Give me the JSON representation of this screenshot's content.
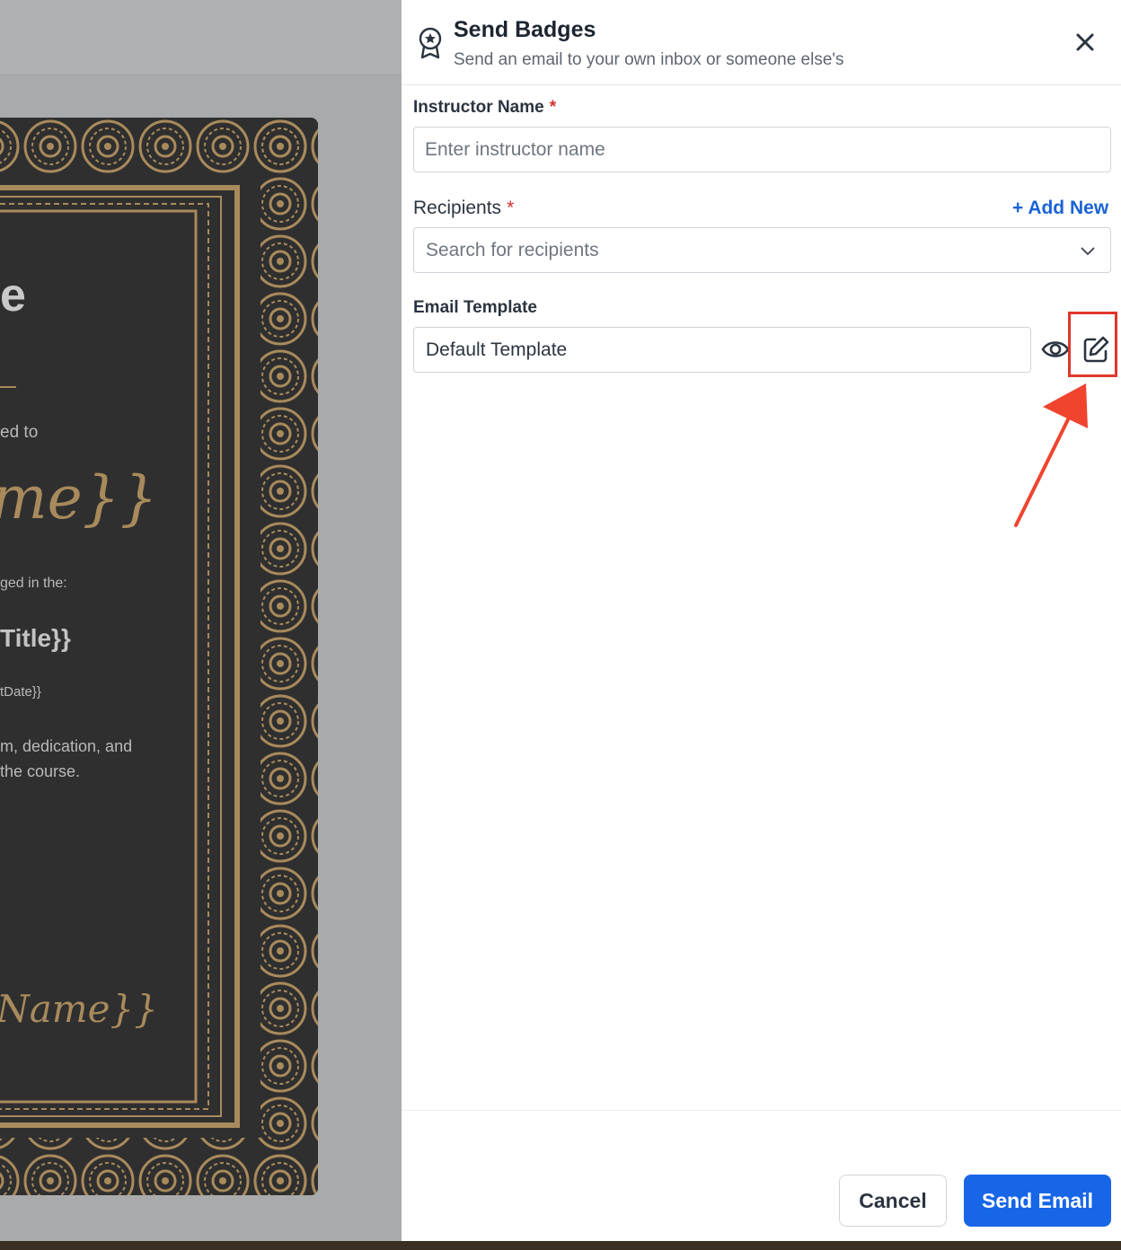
{
  "certificate": {
    "heading_fragment": "e",
    "awarded_fragment": "ed to",
    "name_fragment": "me}}",
    "engaged_fragment": "ged in the:",
    "title_fragment": "Title}}",
    "date_fragment": "tDate}}",
    "body_line1": "m, dedication, and",
    "body_line2": "the course.",
    "signature_fragment": "Name}}"
  },
  "drawer": {
    "title": "Send Badges",
    "subtitle": "Send an email to your own inbox or someone else's",
    "instructor": {
      "label": "Instructor Name",
      "required": "*",
      "placeholder": "Enter instructor name",
      "value": ""
    },
    "recipients": {
      "label": "Recipients",
      "required": "*",
      "add_new": "+ Add New",
      "placeholder": "Search for recipients"
    },
    "email_template": {
      "label": "Email Template",
      "value": "Default Template"
    },
    "footer": {
      "cancel": "Cancel",
      "send": "Send Email"
    }
  },
  "icons": {
    "header": "badge-icon",
    "close": "close-icon",
    "dropdown": "chevron-down-icon",
    "preview": "eye-icon",
    "edit": "edit-icon"
  },
  "colors": {
    "primary": "#1766e8",
    "link": "#1a63d6",
    "required": "#d32f2f",
    "highlight": "#e0372c",
    "certificate_bg": "#2f2f2f",
    "certificate_gold": "#a88a5c"
  }
}
